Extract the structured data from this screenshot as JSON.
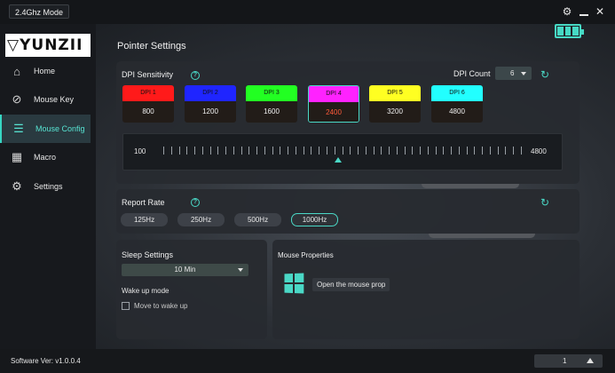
{
  "titlebar": {
    "mode": "2.4Ghz Mode"
  },
  "icons": {
    "settings": "gear-icon",
    "minimize": "minimize-icon",
    "close": "close-icon",
    "battery": "battery-icon"
  },
  "brand": {
    "logo_text": "YUNZII"
  },
  "sidebar": {
    "items": [
      {
        "label": "Home",
        "icon": "home-icon"
      },
      {
        "label": "Mouse Key",
        "icon": "mouse-icon"
      },
      {
        "label": "Mouse Config",
        "icon": "config-icon",
        "active": true
      },
      {
        "label": "Macro",
        "icon": "macro-icon"
      },
      {
        "label": "Settings",
        "icon": "settings-globe-icon"
      }
    ]
  },
  "main": {
    "title": "Pointer Settings"
  },
  "dpi": {
    "title": "DPI Sensitivity",
    "count_label": "DPI Count",
    "count_value": "6",
    "levels": [
      {
        "label": "DPI 1",
        "value": "800",
        "color": "#ff1a1a"
      },
      {
        "label": "DPI 2",
        "value": "1200",
        "color": "#1f25ff"
      },
      {
        "label": "DPI 3",
        "value": "1600",
        "color": "#22ff22"
      },
      {
        "label": "DPI 4",
        "value": "2400",
        "color": "#ff22ff",
        "active": true
      },
      {
        "label": "DPI 5",
        "value": "3200",
        "color": "#ffff22"
      },
      {
        "label": "DPI 6",
        "value": "4800",
        "color": "#22ffff"
      }
    ],
    "slider": {
      "min": "100",
      "max": "4800",
      "value": 2400,
      "range": [
        100,
        4800
      ]
    }
  },
  "report_rate": {
    "title": "Report Rate",
    "options": [
      "125Hz",
      "250Hz",
      "500Hz",
      "1000Hz"
    ],
    "selected": "1000Hz"
  },
  "sleep": {
    "title": "Sleep Settings",
    "value": "10 Min",
    "wake_label": "Wake up mode",
    "move_to_wake": "Move to wake up",
    "move_to_wake_checked": false
  },
  "mouse_properties": {
    "title": "Mouse Properties",
    "button": "Open the mouse prop"
  },
  "footer": {
    "version": "Software Ver: v1.0.0.4",
    "profile": "1"
  },
  "colors": {
    "accent": "#4ad8c6",
    "active_dpi_value": "#ff5a3a"
  }
}
